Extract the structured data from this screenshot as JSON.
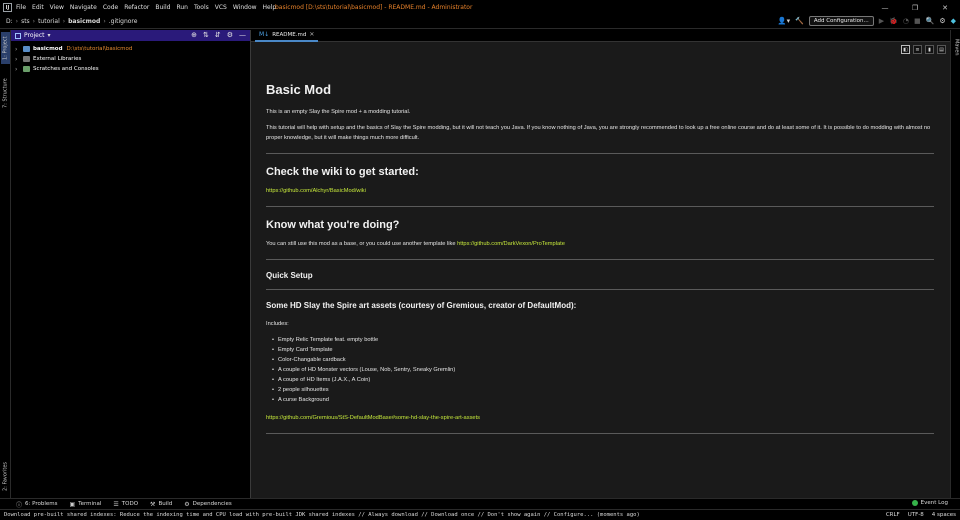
{
  "window": {
    "title": "basicmod [D:\\sts\\tutorial\\basicmod] - README.md - Administrator",
    "controls": [
      "—",
      "❐",
      "✕"
    ]
  },
  "menu": [
    "File",
    "Edit",
    "View",
    "Navigate",
    "Code",
    "Refactor",
    "Build",
    "Run",
    "Tools",
    "VCS",
    "Window",
    "Help"
  ],
  "breadcrumb": [
    "D:",
    "sts",
    "tutorial",
    "basicmod",
    ".gitignore"
  ],
  "toolbar": {
    "config_label": "Add Configuration..."
  },
  "left_tabs": {
    "project": "1: Project",
    "structure": "7: Structure",
    "favorites": "2: Favorites"
  },
  "right_tabs": {
    "maven": "Maven"
  },
  "project": {
    "header": "Project",
    "tree": [
      {
        "name": "basicmod",
        "path": "D:\\sts\\tutorial\\basicmod"
      },
      {
        "name": "External Libraries"
      },
      {
        "name": "Scratches and Consoles"
      }
    ]
  },
  "editor": {
    "tab": "README.md",
    "doc": {
      "h1": "Basic Mod",
      "intro": "This is an empty Slay the Spire mod + a modding tutorial.",
      "intro2": "This tutorial will help with setup and the basics of Slay the Spire modding, but it will not teach you Java. If you know nothing of Java, you are strongly recommended to look up a free online course and do at least some of it. It is possible to do modding with almost no proper knowledge, but it will make things much more difficult.",
      "wiki_heading": "Check the wiki to get started:",
      "wiki_link": "https://github.com/Alchyr/BasicMod/wiki",
      "know_heading": "Know what you're doing?",
      "know_text": "You can still use this mod as a base, or you could use another template like",
      "know_link": "https://github.com/DarkVexon/ProTemplate",
      "setup_heading": "Quick Setup",
      "assets_heading": "Some HD Slay the Spire art assets (courtesy of Gremious, creator of DefaultMod):",
      "includes": "Includes:",
      "items": [
        "Empty Relic Template feat. empty bottle",
        "Empty Card Template",
        "Color-Changable cardback",
        "A couple of HD Monster vectors (Louse, Nob, Sentry, Sneaky Gremlin)",
        "A coupe of HD Items (J.A.X., A Coin)",
        "2 people silhouettes",
        "A curse Background"
      ],
      "assets_link": "https://github.com/Gremious/StS-DefaultModBase#some-hd-slay-the-spire-art-assets"
    }
  },
  "toolwindows": [
    "6: Problems",
    "Terminal",
    "TODO",
    "Build",
    "Dependencies"
  ],
  "event_log": "Event Log",
  "status": {
    "message": "Download pre-built shared indexes: Reduce the indexing time and CPU load with pre-built JDK shared indexes // Always download // Download once // Don't show again // Configure... (moments ago)",
    "line_sep": "CRLF",
    "encoding": "UTF-8",
    "indent": "4 spaces"
  }
}
